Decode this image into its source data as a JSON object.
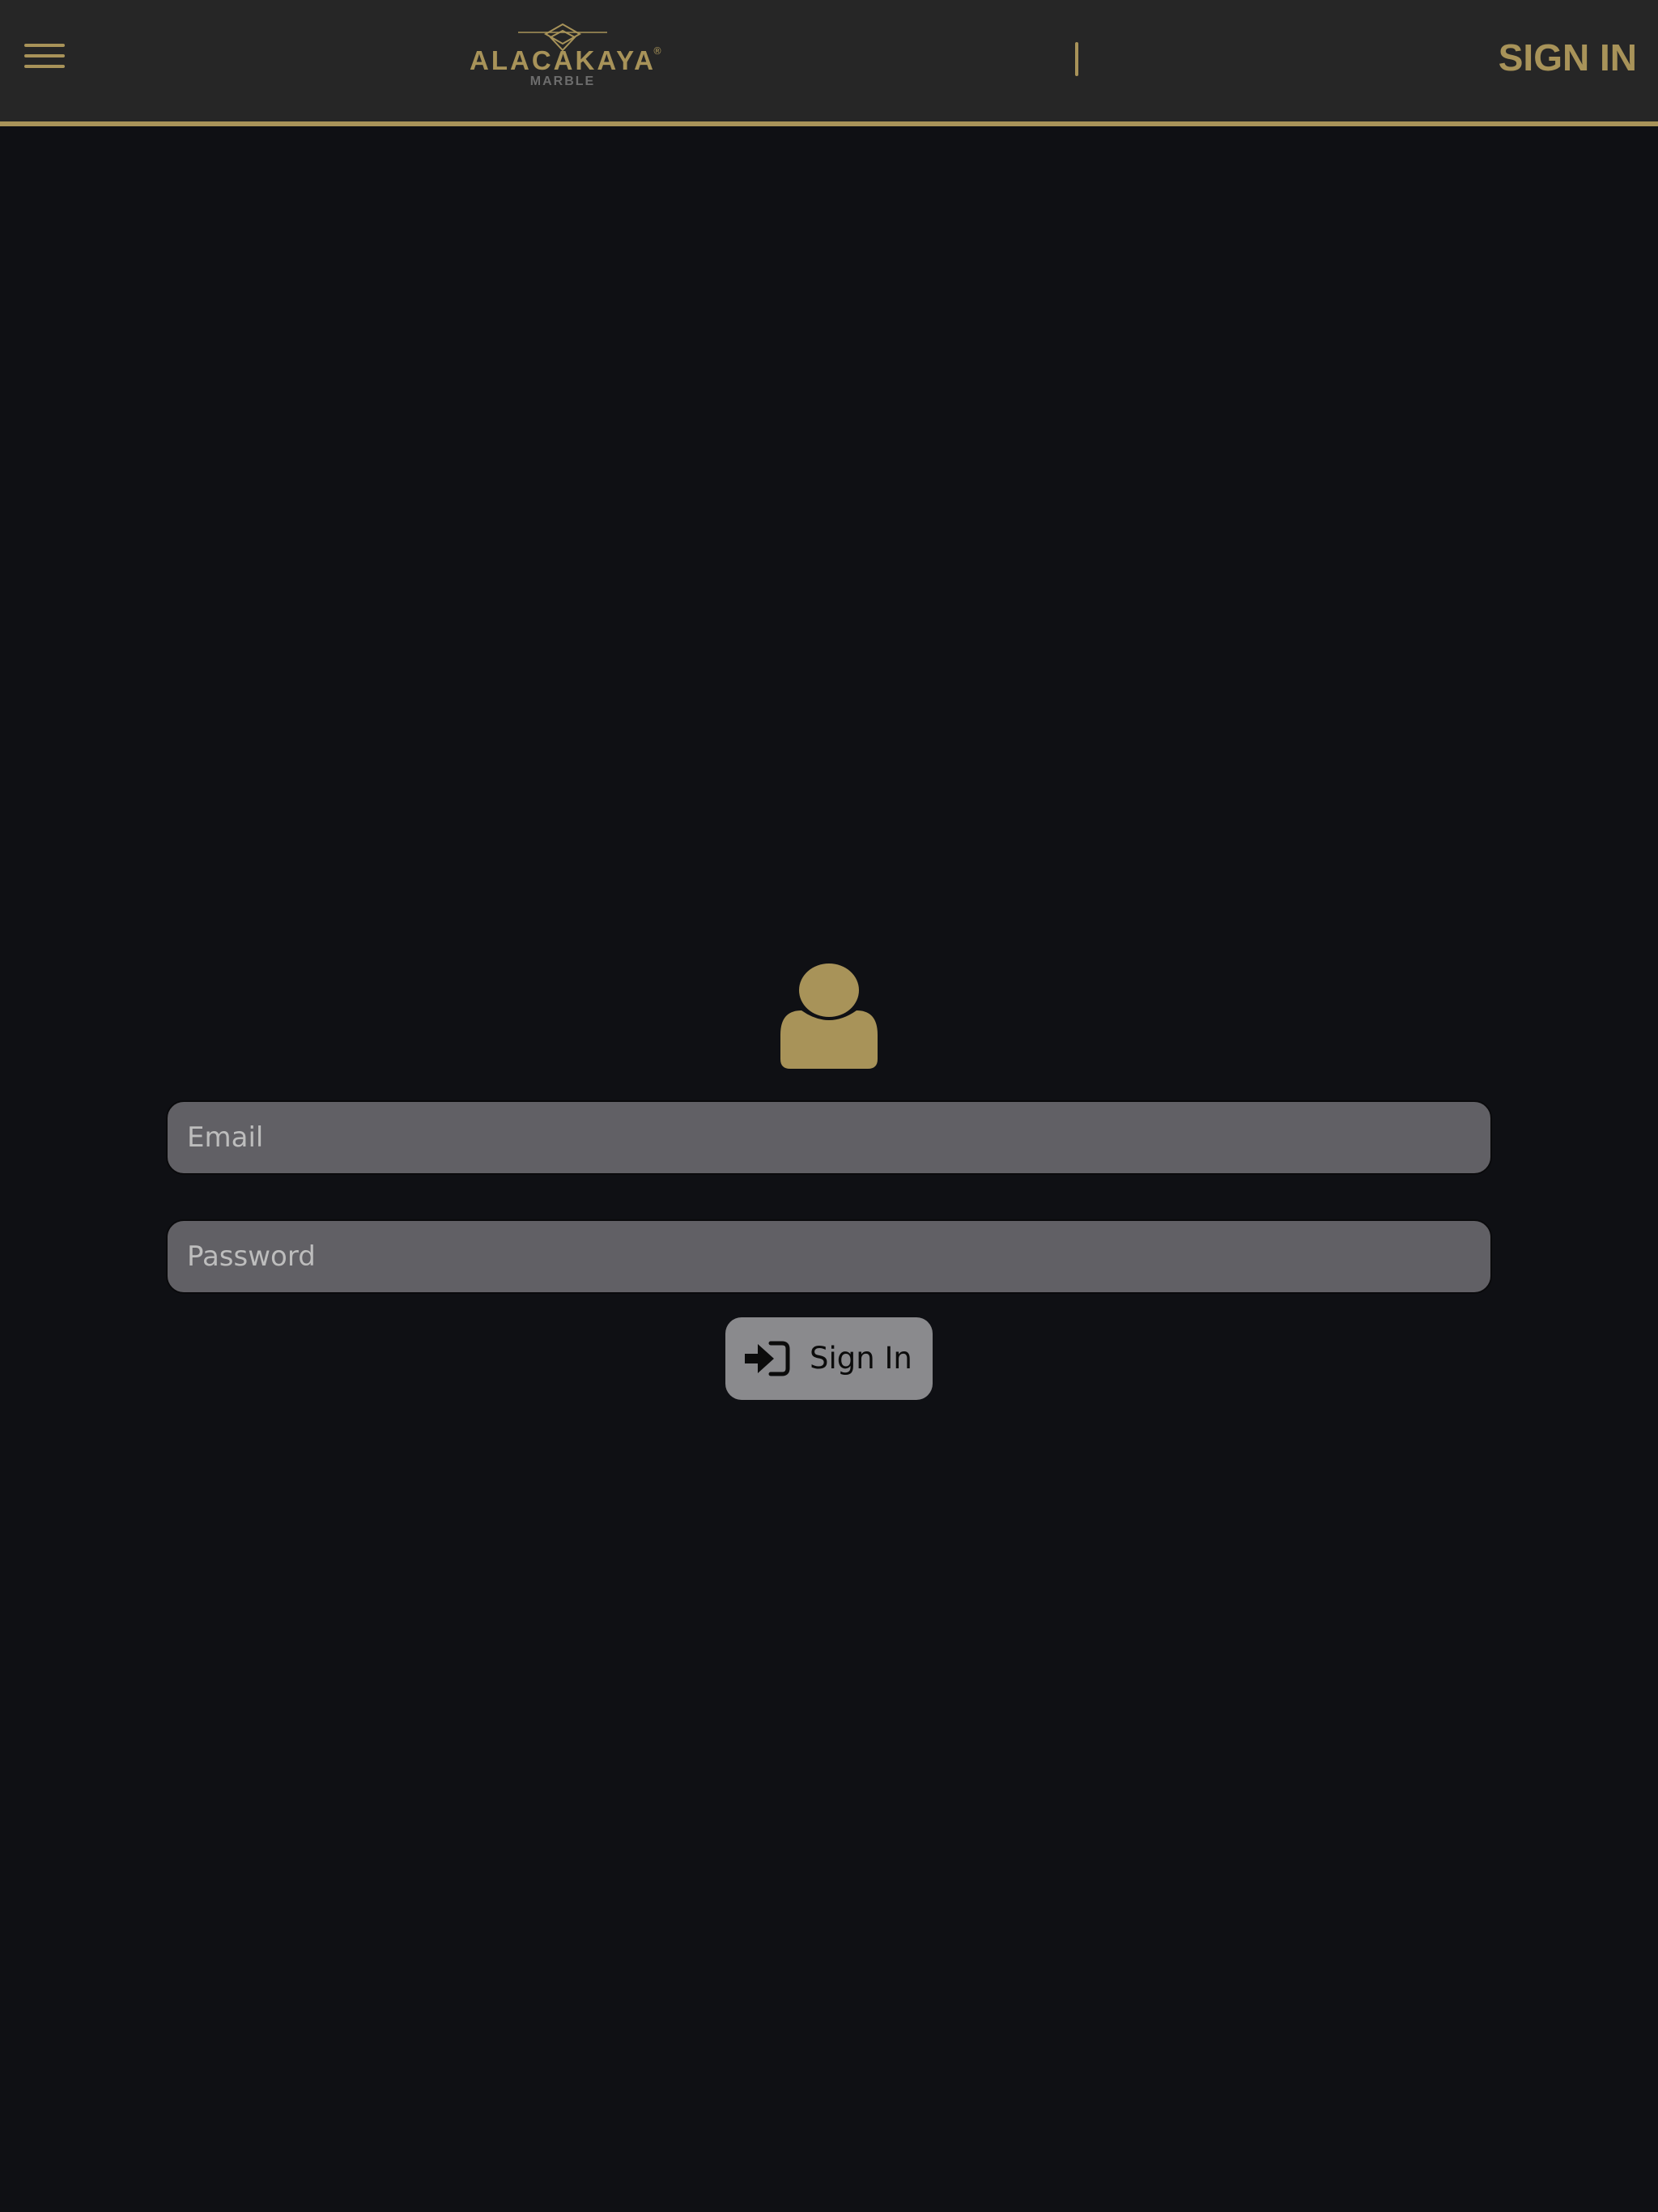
{
  "header": {
    "logo": {
      "brand": "ALACAKAYA",
      "registered_mark": "®",
      "subtitle": "MARBLE"
    },
    "divider": "|",
    "sign_in_label": "SIGN IN",
    "menu_icon": "hamburger-menu-icon"
  },
  "login_form": {
    "avatar_icon": "user-icon",
    "email": {
      "placeholder": "Email",
      "value": ""
    },
    "password": {
      "placeholder": "Password",
      "value": ""
    },
    "submit": {
      "label": "Sign In",
      "icon": "sign-in-icon"
    }
  },
  "colors": {
    "accent": "#a89359",
    "background": "#0f1014",
    "header_bg": "#262626",
    "input_bg": "#616065",
    "button_bg": "#8a8a8d"
  }
}
